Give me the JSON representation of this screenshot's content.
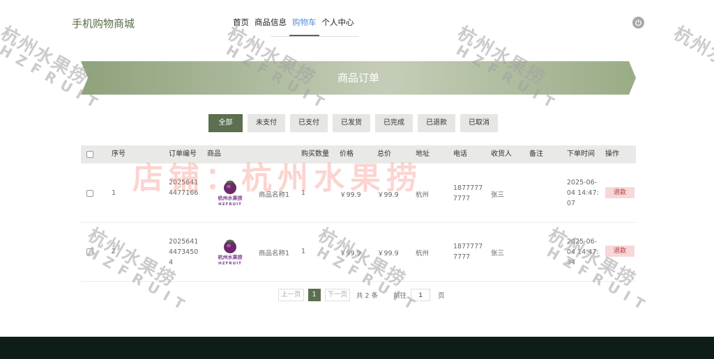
{
  "header": {
    "site_title": "手机购物商城",
    "nav": [
      {
        "label": "首页"
      },
      {
        "label": "商品信息"
      },
      {
        "label": "购物车"
      },
      {
        "label": "个人中心"
      }
    ]
  },
  "banner": {
    "title": "商品订单"
  },
  "tabs": [
    "全部",
    "未支付",
    "已支付",
    "已发货",
    "已完成",
    "已退款",
    "已取消"
  ],
  "table": {
    "headers": [
      "序号",
      "订单编号",
      "商品",
      "购买数量",
      "价格",
      "总价",
      "地址",
      "电话",
      "收货人",
      "备注",
      "下单时间",
      "操作"
    ],
    "rows": [
      {
        "index": "1",
        "order_no_1": "2025641",
        "order_no_2": "4477166",
        "order_no_3": "",
        "product_name": "商品名称1",
        "qty": "1",
        "price": "￥99.9",
        "total": "￥99.9",
        "address": "杭州",
        "phone_1": "1877777",
        "phone_2": "7777",
        "receiver": "张三",
        "note": "",
        "time_1": "2025-06-",
        "time_2": "04 14:47:",
        "time_3": "07",
        "action": "退款"
      },
      {
        "index": "2",
        "order_no_1": "2025641",
        "order_no_2": "4473450",
        "order_no_3": "4",
        "product_name": "商品名称1",
        "qty": "1",
        "price": "￥99.9",
        "total": "￥99.9",
        "address": "杭州",
        "phone_1": "1877777",
        "phone_2": "7777",
        "receiver": "张三",
        "note": "",
        "time_1": "2025-06-",
        "time_2": "04 14:47:",
        "time_3": "34",
        "action": "退款"
      }
    ]
  },
  "pager": {
    "prev": "上一页",
    "current": "1",
    "next": "下一页",
    "total": "共 2 条",
    "goto": "前往",
    "page_input": "1",
    "page_unit": "页"
  },
  "product_logo": {
    "line1": "杭州水果捞",
    "line2": "HZFRUIT"
  },
  "watermark": {
    "main": "店铺：杭州水果捞",
    "tile1": "杭州水果捞",
    "tile2": "HZFRUIT"
  },
  "colors": {
    "accent": "#5c6f4f",
    "nav_active": "#5b8dd6",
    "refund_bg": "#f7d7d7",
    "footer": "#0f1d18"
  }
}
